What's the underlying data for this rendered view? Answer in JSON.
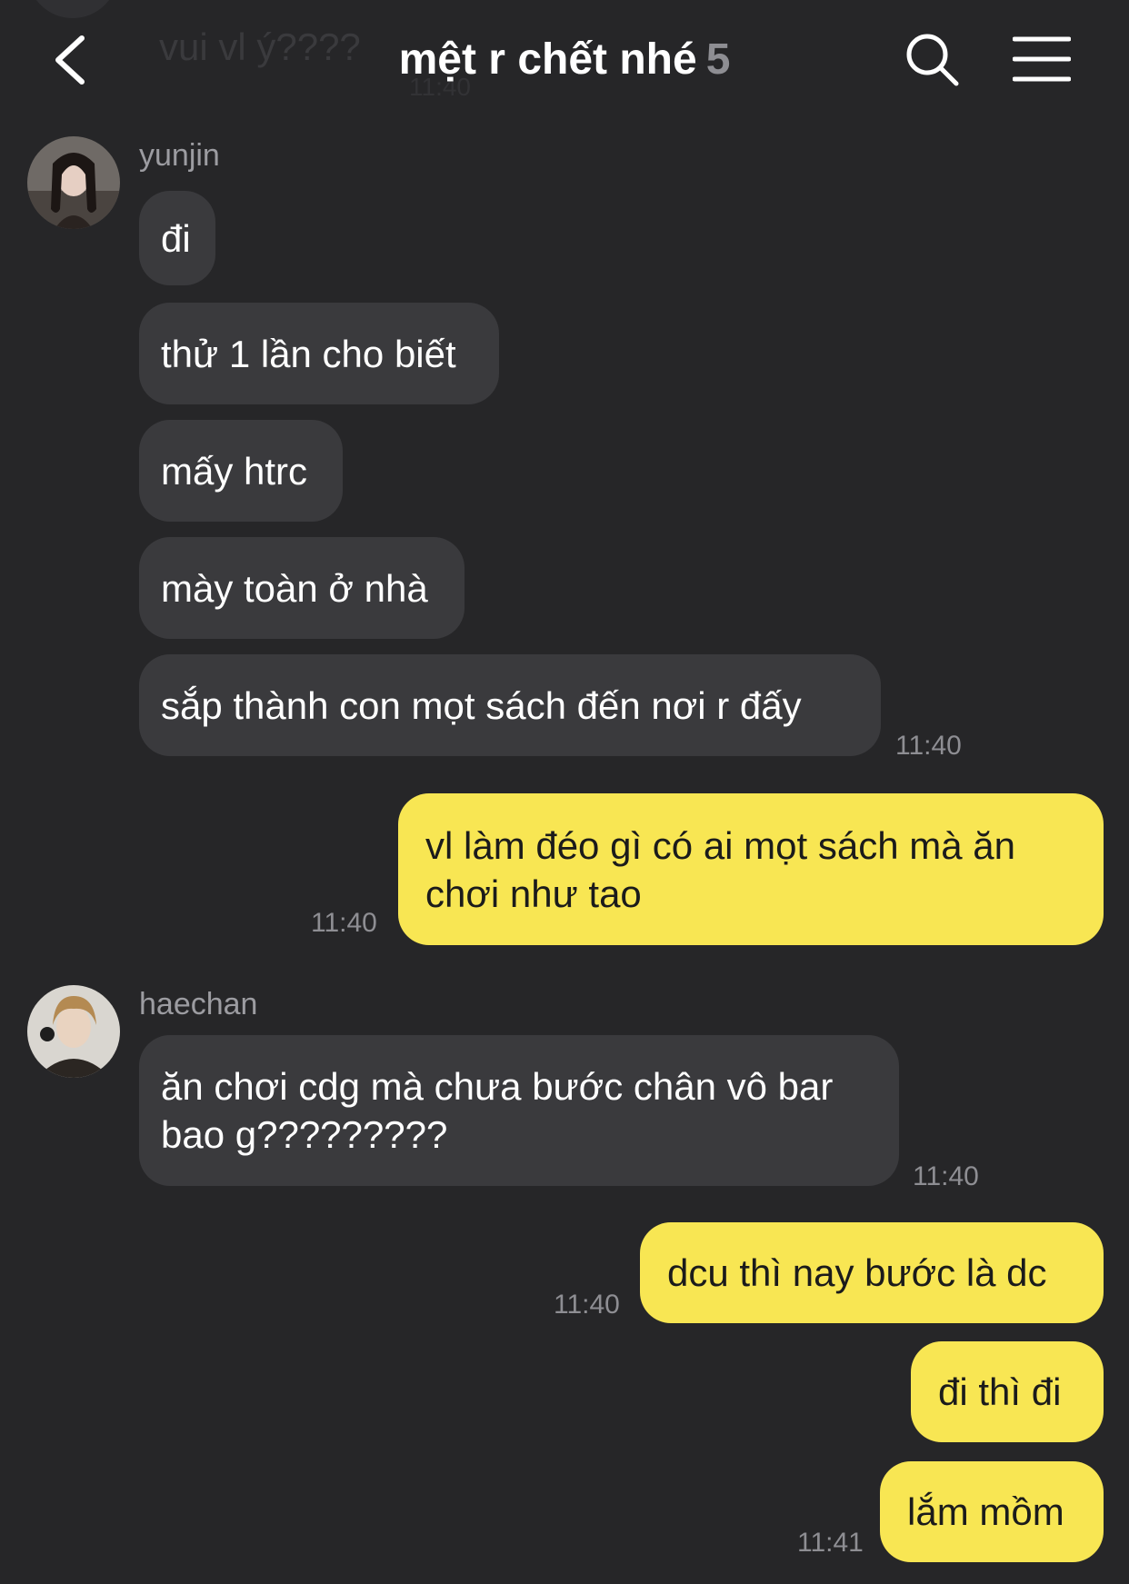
{
  "header": {
    "title": "mệt r chết nhé",
    "member_count": "5",
    "back_icon": "chevron-left-icon",
    "search_icon": "search-icon",
    "menu_icon": "hamburger-menu-icon"
  },
  "previous_message": {
    "text": "vui vl ý????",
    "time": "11:40"
  },
  "colors": {
    "background": "#262628",
    "incoming_bubble": "#3a3a3d",
    "outgoing_bubble": "#f8e653",
    "timestamp": "#8e8e93"
  },
  "groups": [
    {
      "sender": "yunjin",
      "messages": [
        {
          "text": "đi"
        },
        {
          "text": "thử 1 lần cho biết"
        },
        {
          "text": "mấy htrc"
        },
        {
          "text": "mày toàn ở nhà"
        },
        {
          "text": "sắp thành con mọt sách đến nơi r đấy",
          "time": "11:40"
        }
      ]
    },
    {
      "sender": "me",
      "messages": [
        {
          "text": "vl làm đéo gì có ai mọt sách mà ăn chơi như tao",
          "time": "11:40"
        }
      ]
    },
    {
      "sender": "haechan",
      "messages": [
        {
          "text": "ăn chơi cdg mà chưa bước chân vô bar bao g?????????",
          "time": "11:40"
        }
      ]
    },
    {
      "sender": "me",
      "messages": [
        {
          "text": "dcu thì nay bước là dc",
          "time": "11:40"
        },
        {
          "text": "đi thì đi"
        },
        {
          "text": "lắm mồm",
          "time": "11:41"
        }
      ]
    }
  ]
}
